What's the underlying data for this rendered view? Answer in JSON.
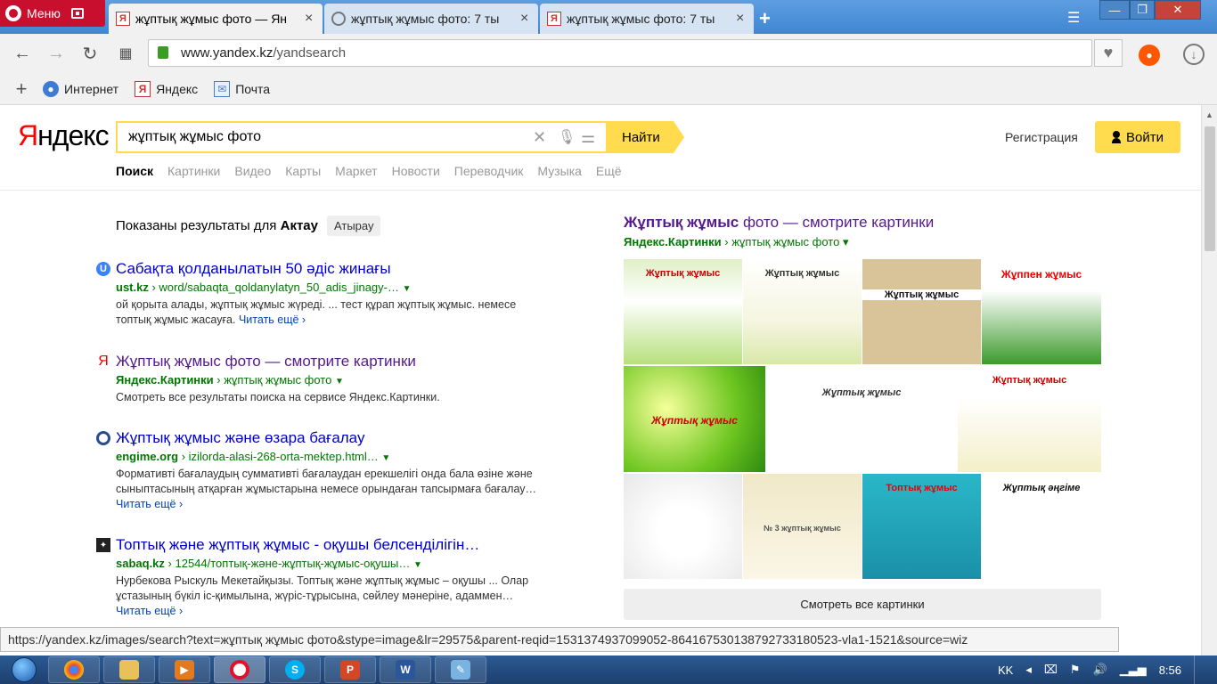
{
  "browser": {
    "menu_label": "Меню",
    "tabs": [
      {
        "label": "жұптық жұмыс фото — Ян",
        "active": true
      },
      {
        "label": "жұптық жұмыс фото: 7 ты",
        "active": false
      },
      {
        "label": "жұптық жұмыс фото: 7 ты",
        "active": false
      }
    ],
    "url_host": "www.yandex.kz",
    "url_path": "/yandsearch",
    "bookmarks": [
      "Интернет",
      "Яндекс",
      "Почта"
    ]
  },
  "yandex": {
    "logo_first": "Я",
    "logo_rest": "ндекс",
    "query": "жұптық жұмыс фото",
    "find_label": "Найти",
    "register_label": "Регистрация",
    "login_label": "Войти",
    "services": [
      "Поиск",
      "Картинки",
      "Видео",
      "Карты",
      "Маркет",
      "Новости",
      "Переводчик",
      "Музыка",
      "Ещё"
    ],
    "region_prefix": "Показаны результаты для",
    "region_city": "Актау",
    "region_chip": "Атырау"
  },
  "results": [
    {
      "title": "Сабақта қолданылатын 50 әдіс жинағы",
      "host": "ust.kz",
      "path": "word/sabaqta_qoldanylatyn_50_adis_jinagy-…",
      "snippet_1": "ой қорыта алады, жұптық жұмыс жүреді. ... тест құрап жұптық жұмыс. немесе",
      "snippet_2": "топтық жұмыс жасауға.",
      "more": "Читать ещё ›"
    },
    {
      "title_bold": "Жұптық жұмыс",
      "title_rest": " фото — смотрите картинки",
      "host": "Яндекс.Картинки",
      "path": "жұптық жұмыс фото",
      "snippet_1": "Смотреть все результаты поиска на сервисе Яндекс.Картинки."
    },
    {
      "title_bold": "Жұптық жұмыс",
      "title_rest": " және өзара бағалау",
      "host": "engime.org",
      "path": "izilorda-alasi-268-orta-mektep.html…",
      "snippet_1": "Формативті бағалаудың суммативті бағалаудан ерекшелігі онда бала өзіне және",
      "snippet_2": "сыныптасының атқарған жұмыстарына немесе орындаған тапсырмаға бағалау…",
      "more": "Читать ещё ›"
    },
    {
      "title_pre": "Топтық және ",
      "title_bold": "жұптық жұмыс",
      "title_rest": " - оқушы белсенділігін…",
      "host": "sabaq.kz",
      "path": "12544/топтық-және-жұптық-жұмыс-оқушы…",
      "snippet_1": "Нурбекова Рыскуль Мекетайқызы. Топтық және жұптық жұмыс – оқушы ... Олар",
      "snippet_2": "ұстазының бүкіл іс-қимылына, жүріс-тұрысына, сөйлеу мәнеріне, адаммен…",
      "more": "Читать ещё ›"
    }
  ],
  "images": {
    "title_bold": "Жұптық жұмыс",
    "title_rest": " фото — смотрите картинки",
    "host": "Яндекс.Картинки",
    "path": "жұптық жұмыс фото",
    "tile_captions": [
      "Жұптық жұмыс",
      "Жұптық жұмыс",
      "Жұптық жұмыс",
      "Жұппен жұмыс",
      "Жұптық жұмыс",
      "Жұптық жұмыс",
      "Жұптық жұмыс",
      "",
      "№ 3 жұптық жұмыс",
      "Топтық жұмыс",
      "Жұптық әңгіме"
    ],
    "see_all": "Смотреть все картинки"
  },
  "status_url": "https://yandex.kz/images/search?text=жұптық жұмыс фото&stype=image&lr=29575&parent-reqid=1531374937099052-864167530138792733180523-vla1-1521&source=wiz",
  "taskbar": {
    "lang": "KK",
    "time": "8:56"
  }
}
